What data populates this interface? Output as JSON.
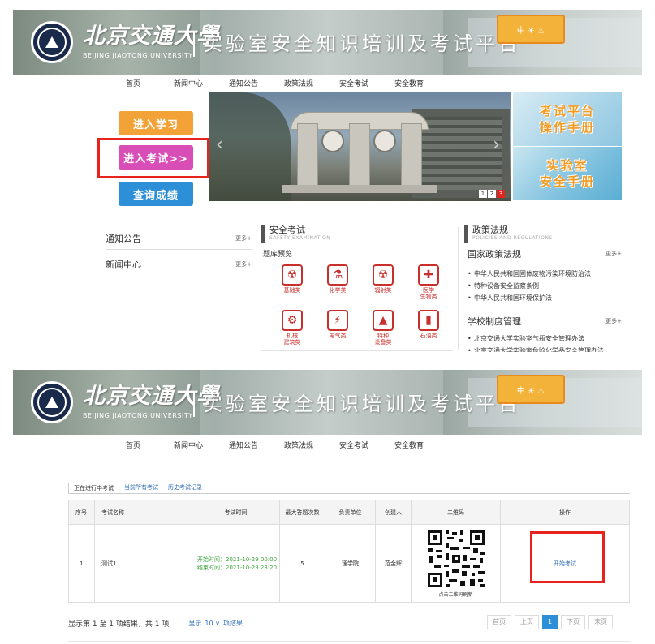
{
  "banner": {
    "university_cn": "北京交通大學",
    "university_en": "BEIJING JIAOTONG UNIVERSITY",
    "platform_title": "实验室安全知识培训及考试平台",
    "stamp_text": "中 ☀ ♨"
  },
  "nav": [
    "首页",
    "新闻中心",
    "通知公告",
    "政策法规",
    "安全考试",
    "安全教育"
  ],
  "actions": {
    "learn": "进入学习",
    "exam": "进入考试>>",
    "score": "查询成绩"
  },
  "carousel": {
    "prev": "‹",
    "next": "›",
    "dots": [
      "1",
      "2",
      "3"
    ]
  },
  "side_cards": [
    {
      "line1": "考试平台",
      "line2": "操作手册"
    },
    {
      "line1": "实验室",
      "line2": "安全手册"
    }
  ],
  "lists": {
    "notice": "通知公告",
    "news": "新闻中心",
    "more": "更多+"
  },
  "safety": {
    "title": "安全考试",
    "subtitle": "SAFETY EXAMINATION",
    "bank_label": "题库预览",
    "items": [
      {
        "label": "基础类",
        "icon": "☢"
      },
      {
        "label": "化学类",
        "icon": "⚗"
      },
      {
        "label": "辐射类",
        "icon": "☢"
      },
      {
        "label": "医学\n生物类",
        "icon": "✚"
      },
      {
        "label": "机械\n建筑类",
        "icon": "⚙"
      },
      {
        "label": "电气类",
        "icon": "⚡"
      },
      {
        "label": "特种\n设备类",
        "icon": "▲"
      },
      {
        "label": "石油类",
        "icon": "▮"
      }
    ]
  },
  "policy": {
    "title": "政策法规",
    "subtitle": "POLICIES AND REGULATIONS",
    "national": "国家政策法规",
    "national_items": [
      "中华人民共和国固体废物污染环境防治法",
      "特种设备安全监察条例",
      "中华人民共和国环境保护法"
    ],
    "school": "学校制度管理",
    "school_items": [
      "北京交通大学实验室气瓶安全管理办法",
      "北京交通大学实验室危险化学品安全管理办法"
    ],
    "more": "更多+"
  },
  "exam_tabs": [
    "正在进行中考试",
    "当前所有考试",
    "历史考试记录"
  ],
  "table": {
    "headers": [
      "序号",
      "考试名称",
      "考试时间",
      "最大答题次数",
      "负责单位",
      "创建人",
      "二维码",
      "操作"
    ],
    "rows": [
      {
        "index": "1",
        "name": "测试1",
        "start": "开始时间：2021-10-29 00:00",
        "end": "结束时间：2021-10-29 23:20",
        "max_attempts": "5",
        "unit": "理学院",
        "creator": "范金辉",
        "qr_caption": "点击二维码刷新",
        "action": "开始考试"
      }
    ]
  },
  "footer": {
    "summary": "显示第 1 至 1 项结果，共 1 项",
    "show_label": "显示",
    "page_size": "10 ∨",
    "page_size_suffix": "项结果",
    "pager": [
      "首页",
      "上页",
      "1",
      "下页",
      "末页"
    ]
  }
}
